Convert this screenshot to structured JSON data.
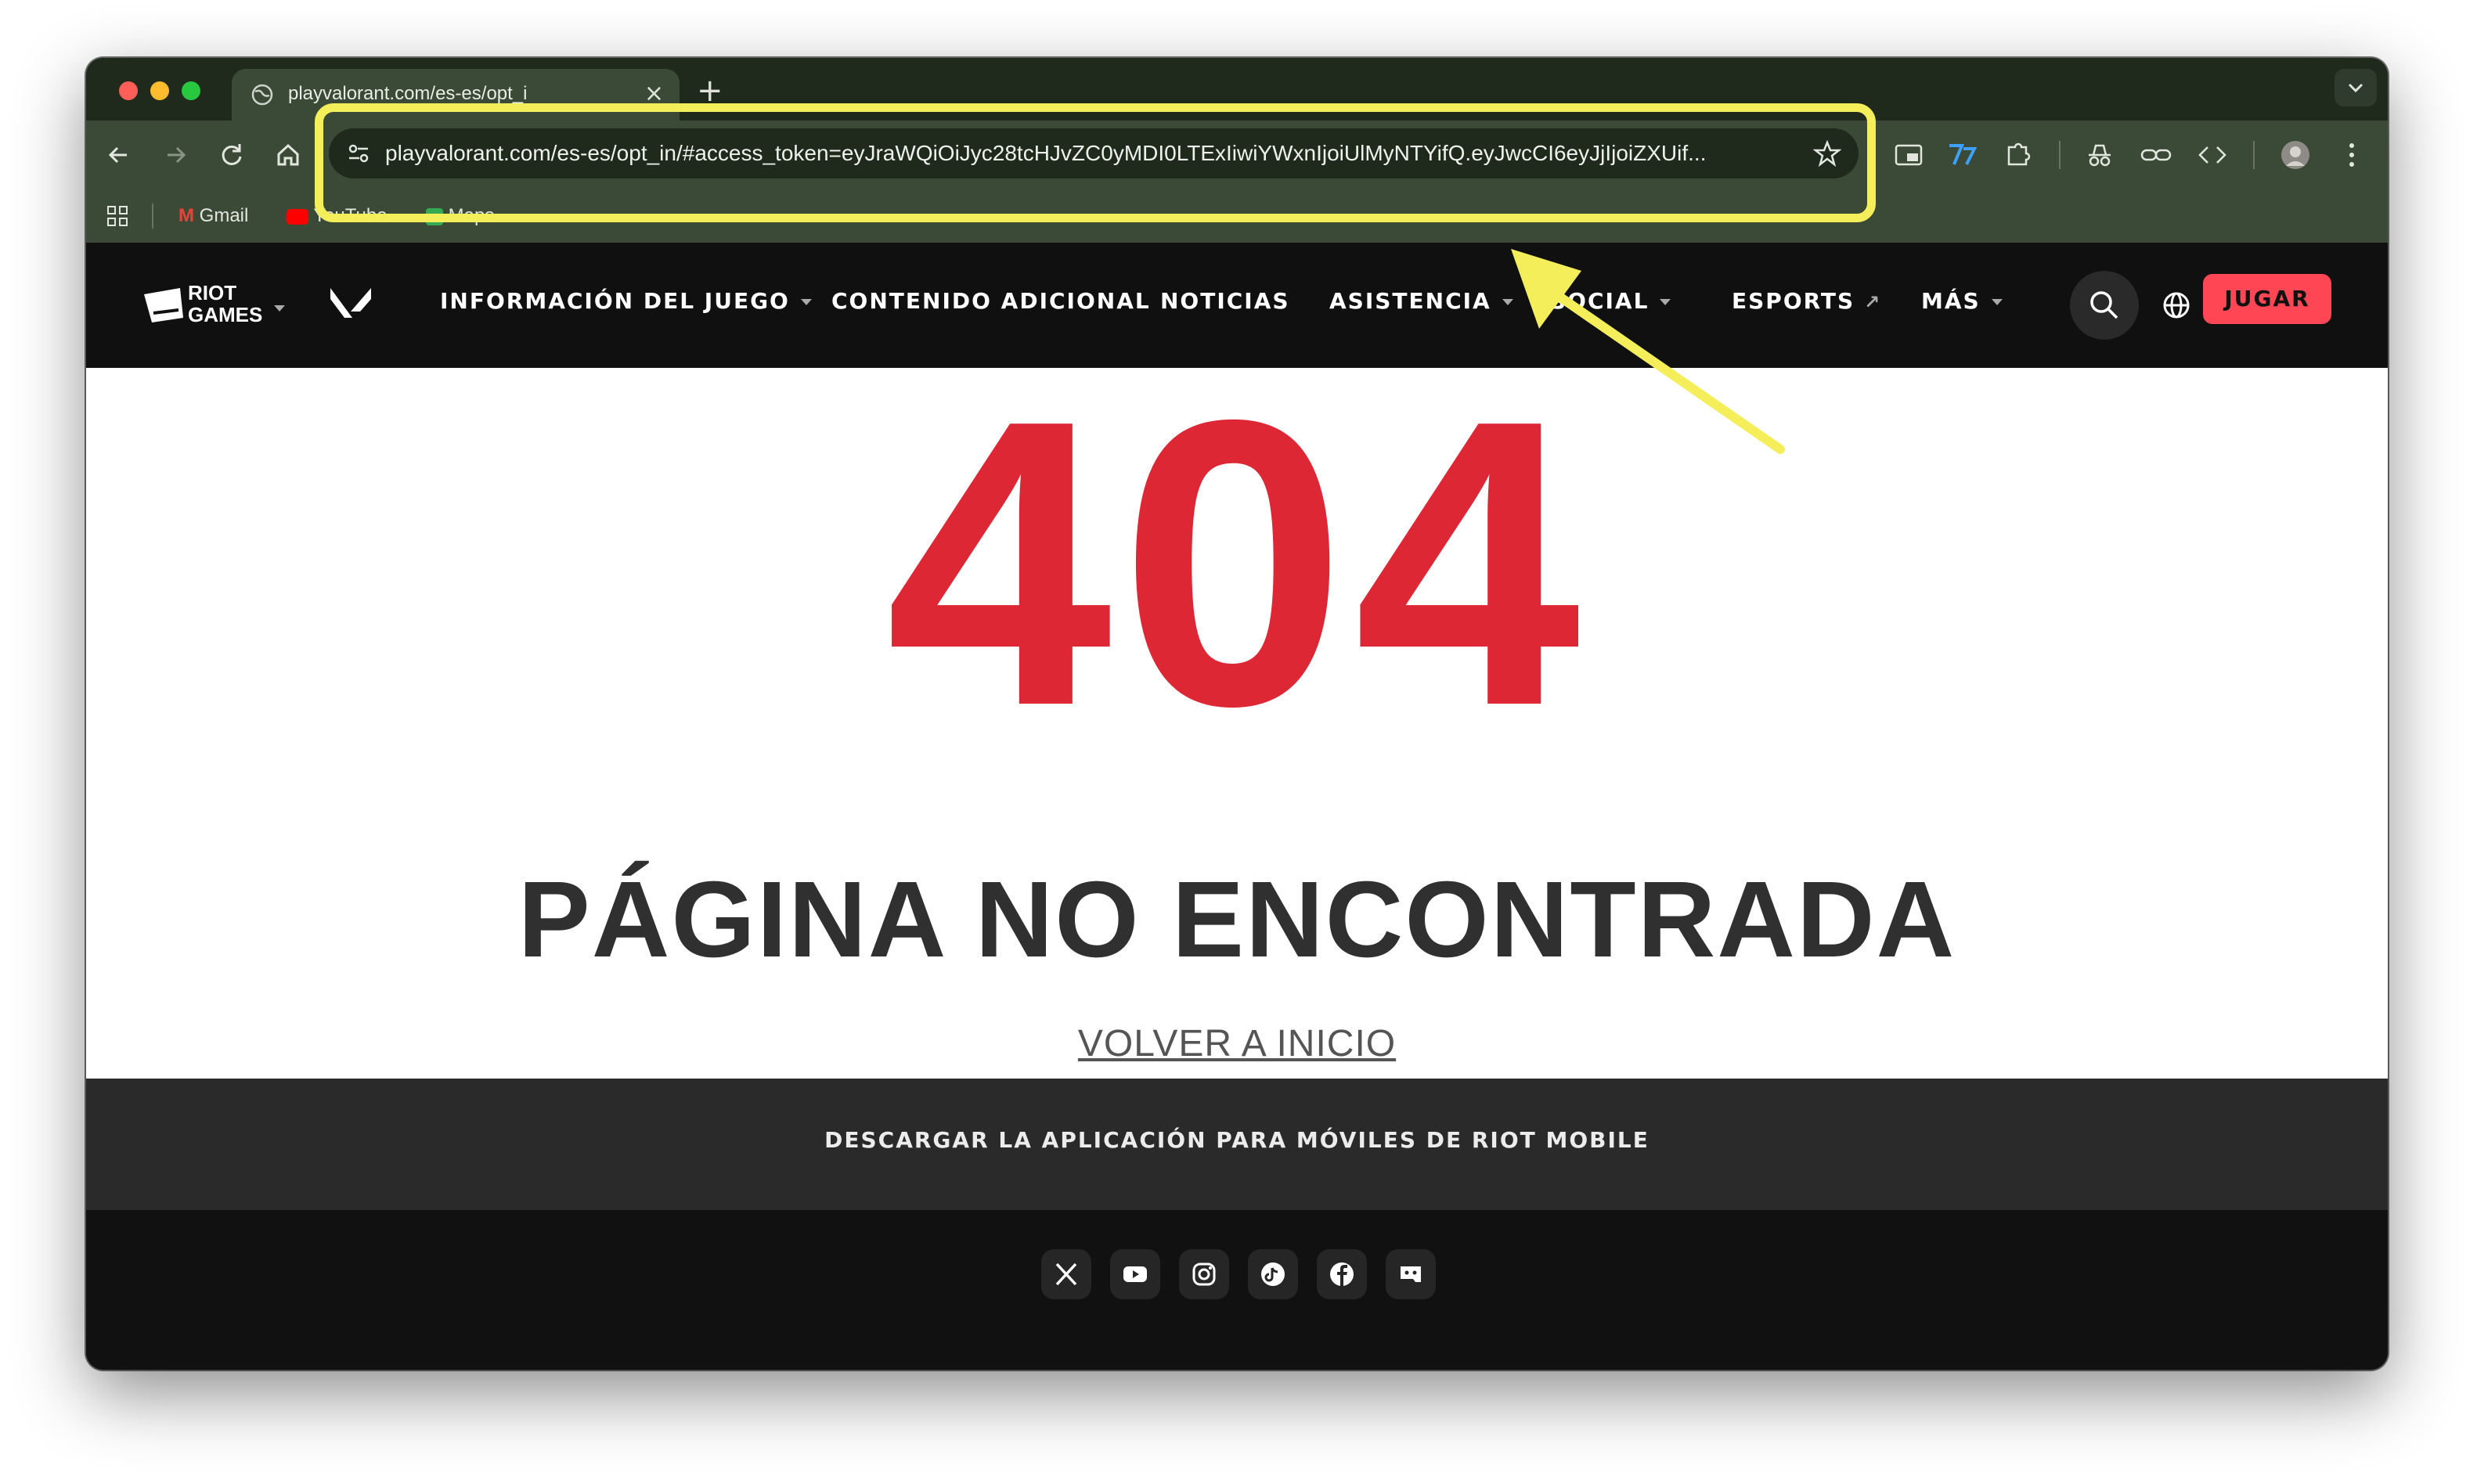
{
  "browser": {
    "tab_title": "playvalorant.com/es-es/opt_i",
    "tab_close": "×",
    "new_tab": "+",
    "url": "playvalorant.com/es-es/opt_in/#access_token=eyJraWQiOiJyc28tcHJvZC0yMDI0LTExIiwiYWxnIjoiUlMyNTYifQ.eyJwcCI6eyJjIjoiZXUif...",
    "bookmarks": [
      "Gmail",
      "YouTube",
      "Maps"
    ],
    "colors": {
      "frame": "#1f2a1d",
      "toolbar": "#3a4a36",
      "highlight": "#f4ee5a"
    }
  },
  "site": {
    "logo_text_line1": "RIOT",
    "logo_text_line2": "GAMES",
    "nav": [
      {
        "label": "INFORMACIÓN DEL JUEGO",
        "has_dropdown": true
      },
      {
        "label": "CONTENIDO ADICIONAL",
        "has_dropdown": false
      },
      {
        "label": "NOTICIAS",
        "has_dropdown": false
      },
      {
        "label": "ASISTENCIA",
        "has_dropdown": true
      },
      {
        "label": "SOCIAL",
        "has_dropdown": true
      },
      {
        "label": "ESPORTS",
        "has_dropdown": false,
        "external": true
      },
      {
        "label": "MÁS",
        "has_dropdown": true
      }
    ],
    "external_glyph": "↗",
    "play_button": "JUGAR",
    "accent": "#ff4655"
  },
  "content": {
    "error_code": "404",
    "error_message": "PÁGINA NO ENCONTRADA",
    "home_link": "VOLVER A INICIO"
  },
  "footer": {
    "mobile_banner": "DESCARGAR LA APLICACIÓN PARA MÓVILES DE RIOT MOBILE",
    "social_icons": [
      "x-icon",
      "youtube-icon",
      "instagram-icon",
      "tiktok-icon",
      "facebook-icon",
      "discord-icon"
    ]
  }
}
